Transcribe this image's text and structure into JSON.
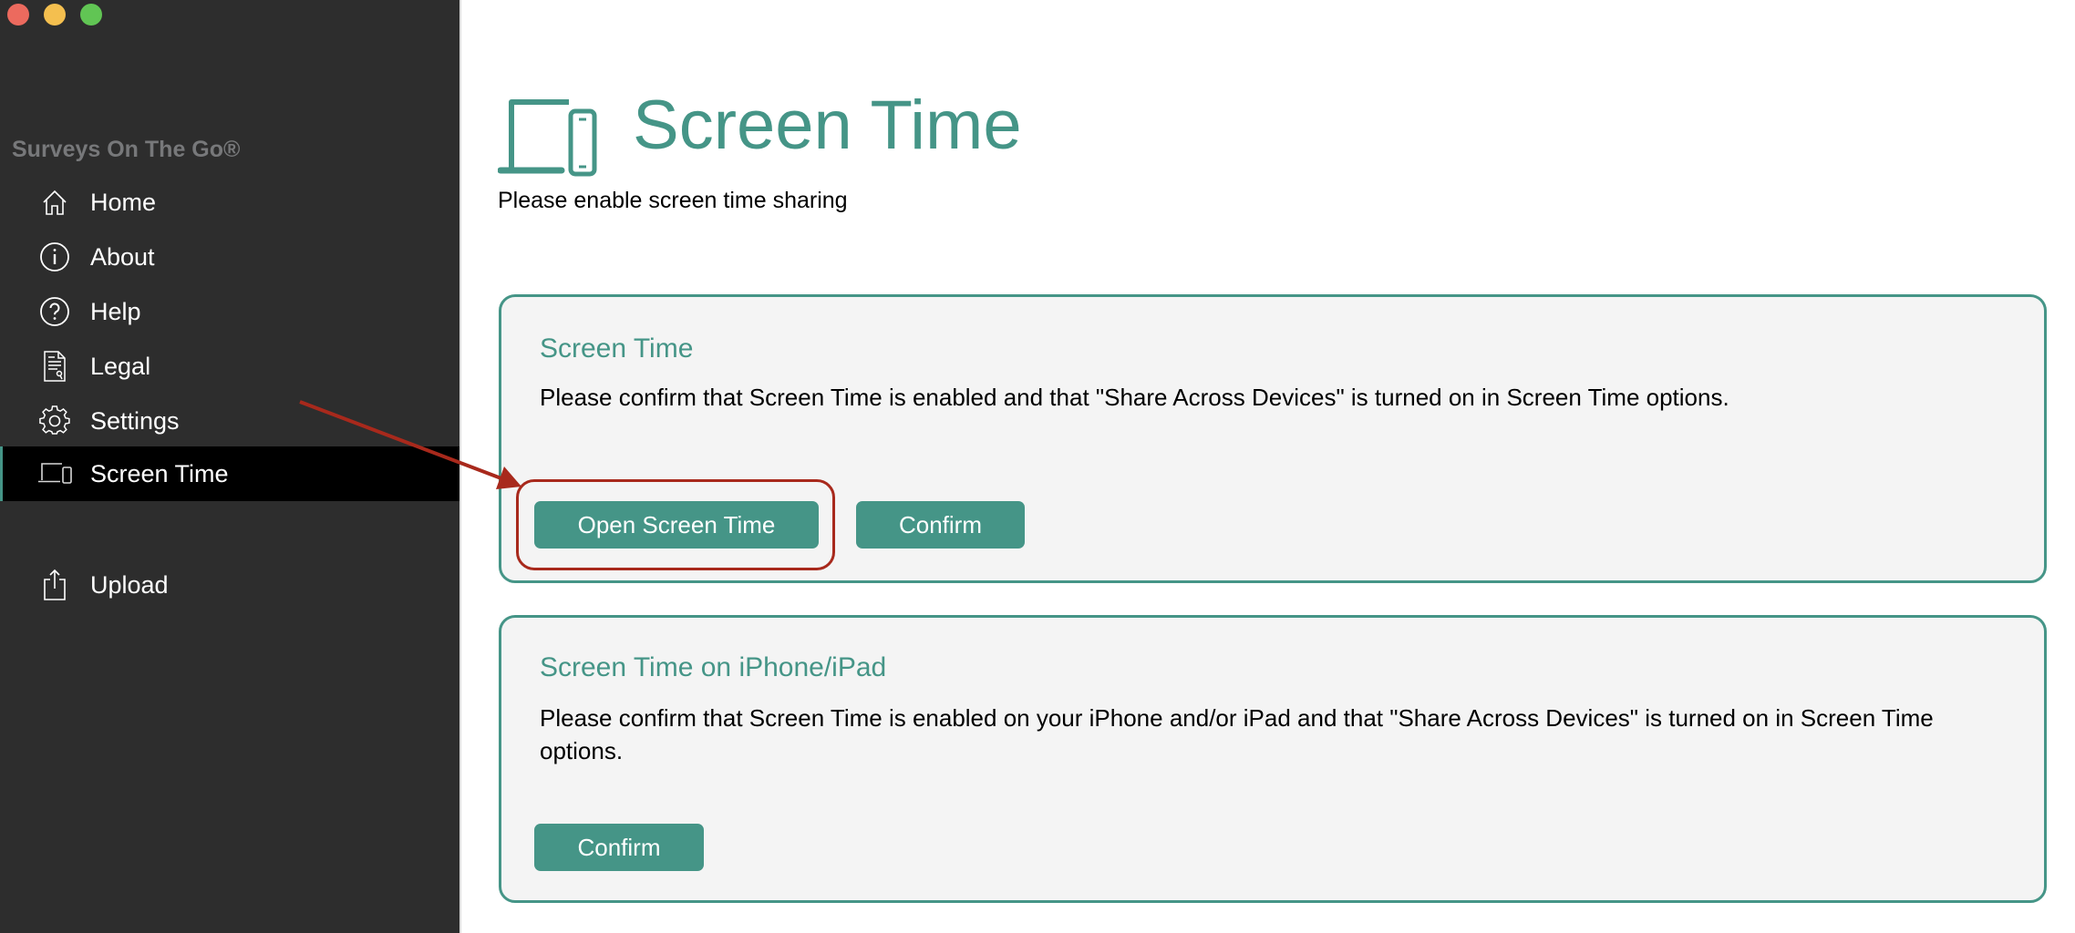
{
  "window": {
    "controls": [
      {
        "name": "close",
        "color": "#ec6a5e"
      },
      {
        "name": "minimize",
        "color": "#f4bf4f"
      },
      {
        "name": "zoom",
        "color": "#61c554"
      }
    ]
  },
  "sidebar": {
    "brand": "Surveys On The Go®",
    "items": [
      {
        "label": "Home",
        "icon": "home-icon",
        "active": false
      },
      {
        "label": "About",
        "icon": "info-icon",
        "active": false
      },
      {
        "label": "Help",
        "icon": "help-icon",
        "active": false
      },
      {
        "label": "Legal",
        "icon": "legal-document-icon",
        "active": false
      },
      {
        "label": "Settings",
        "icon": "gear-icon",
        "active": false
      },
      {
        "label": "Screen Time",
        "icon": "laptop-phone-icon",
        "active": true
      },
      {
        "label": "Upload",
        "icon": "share-upload-icon",
        "active": false
      }
    ]
  },
  "header": {
    "icon": "laptop-phone-icon",
    "title": "Screen Time",
    "subtitle": "Please enable screen time sharing"
  },
  "cards": [
    {
      "title": "Screen Time",
      "body": "Please confirm that Screen Time is enabled and that \"Share Across Devices\" is turned on in Screen Time options.",
      "buttons": [
        "Open Screen Time",
        "Confirm"
      ]
    },
    {
      "title": "Screen Time on iPhone/iPad",
      "body": "Please confirm that Screen Time is enabled on your iPhone and/or iPad and that \"Share Across Devices\" is turned on in Screen Time options.",
      "buttons": [
        "Confirm"
      ]
    }
  ],
  "annotation": {
    "type": "arrow-highlight",
    "target": "Open Screen Time",
    "color": "#a8291c"
  },
  "colors": {
    "accent": "#459587",
    "sidebar_bg": "#2d2d2d",
    "active_row_bg": "#000000",
    "card_bg": "#f4f4f4",
    "brand_text": "#77787a"
  }
}
